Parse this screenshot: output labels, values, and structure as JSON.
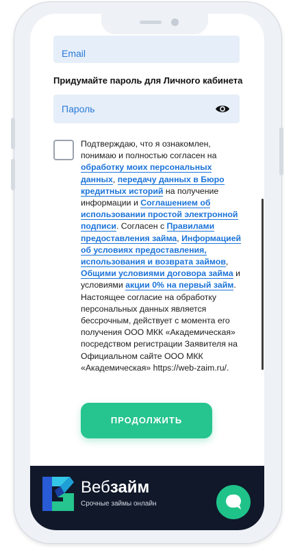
{
  "form": {
    "email_placeholder": "Email",
    "password_title": "Придумайте пароль для Личного кабинета",
    "password_placeholder": "Пароль"
  },
  "consent": {
    "t1": "Подтверждаю, что я ознакомлен, понимаю и полностью согласен на ",
    "l1": "обработку моих персональных данных",
    "t2": ", ",
    "l2": "передачу данных в Бюро кредитных историй",
    "t3": " на получение информации и ",
    "l3": "Соглашением об использовании простой электронной подписи",
    "t4": ". Согласен с ",
    "l4": "Правилами предоставления займа",
    "t5": ", ",
    "l5": "Информацией об условиях предоставления, использования и возврата займов",
    "t6": ", ",
    "l6": "Общими условиями договора займа",
    "t7": " и условиями ",
    "l7": "акции 0% на первый займ",
    "t8": ".",
    "p2": "Настоящее согласие на обработку персональных данных является бессрочным, действует с момента его получения ООО МКК «Академическая» посредством регистрации Заявителя на Официальном сайте ООО МКК «Академическая» https://web-zaim.ru/."
  },
  "actions": {
    "continue_label": "ПРОДОЛЖИТЬ"
  },
  "footer": {
    "brand_regular": "Веб",
    "brand_bold": "займ",
    "tagline": "Срочные займы онлайн"
  },
  "icons": {
    "password_toggle": "eye-icon",
    "chat": "chat-icon",
    "logo": "logo-icon"
  },
  "colors": {
    "accent_green": "#26c48e",
    "link_blue": "#1a73d9",
    "footer_bg": "#10182a",
    "input_bg": "#e6eef9"
  }
}
